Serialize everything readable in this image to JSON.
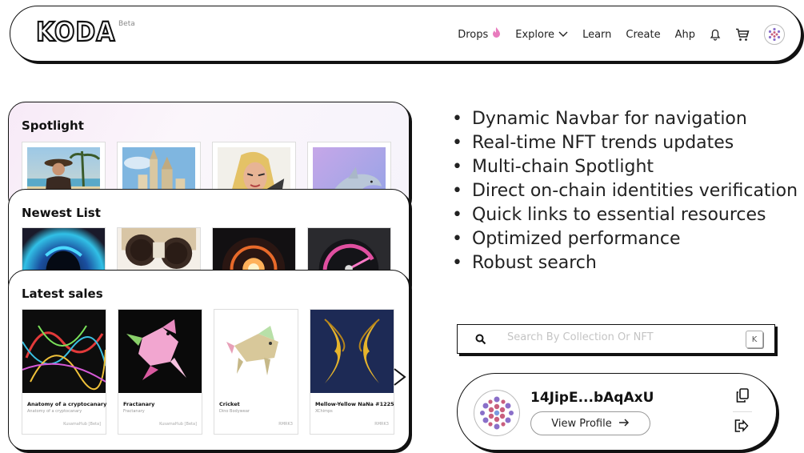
{
  "navbar": {
    "logo_text": "KODA",
    "beta_label": "Beta",
    "items": [
      {
        "label": "Drops"
      },
      {
        "label": "Explore"
      },
      {
        "label": "Learn"
      },
      {
        "label": "Create"
      },
      {
        "label": "Ahp"
      }
    ],
    "icons": [
      "flame-icon",
      "chevron-down-icon",
      "bell-icon",
      "cart-icon",
      "avatar"
    ]
  },
  "spotlight": {
    "title": "Spotlight"
  },
  "newest": {
    "title": "Newest List"
  },
  "latest": {
    "title": "Latest sales",
    "items": [
      {
        "name": "Anatomy of a cryptocanary",
        "sub": "Anatomy of a cryptocanary",
        "source": "KusamaHub [Beta]"
      },
      {
        "name": "Fractanary",
        "sub": "Fractanary",
        "source": "KusamaHub [Beta]"
      },
      {
        "name": "Cricket",
        "sub": "Dino Bodywear",
        "source": "RMRK3"
      },
      {
        "name": "Mellow-Yellow NaNa #1225",
        "sub": "XChimps",
        "source": "RMRK3"
      }
    ]
  },
  "features": [
    "Dynamic Navbar for navigation",
    "Real-time NFT trends updates",
    "Multi-chain Spotlight",
    "Direct on-chain identities verification",
    "Quick links to essential resources",
    "Optimized performance",
    "Robust search"
  ],
  "search": {
    "placeholder": "Search By Collection Or NFT",
    "shortcut": "K"
  },
  "profile": {
    "address": "14JipE...bAqAxU",
    "view_label": "View Profile"
  },
  "colors": {
    "accent": "#e87bbd",
    "border": "#111111"
  }
}
